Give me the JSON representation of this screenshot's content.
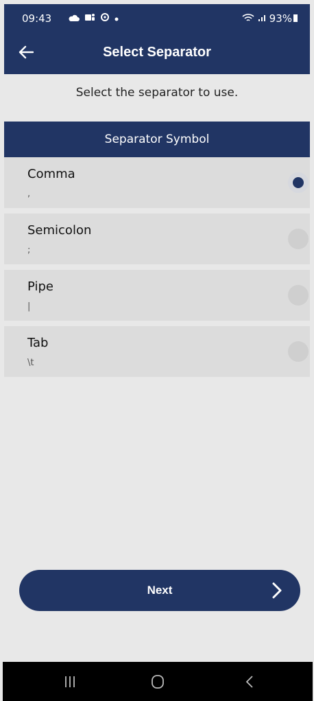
{
  "status_bar": {
    "time": "09:43",
    "battery": "93%"
  },
  "app_bar": {
    "title": "Select Separator"
  },
  "instruction": "Select the separator to use.",
  "section_header": "Separator Symbol",
  "options": [
    {
      "label": "Comma",
      "symbol": ",",
      "selected": true
    },
    {
      "label": "Semicolon",
      "symbol": ";",
      "selected": false
    },
    {
      "label": "Pipe",
      "symbol": "|",
      "selected": false
    },
    {
      "label": "Tab",
      "symbol": "\\t",
      "selected": false
    }
  ],
  "next_button": {
    "label": "Next"
  },
  "colors": {
    "primary": "#213564",
    "background": "#e8e8e8",
    "row": "#dcdcdc"
  }
}
